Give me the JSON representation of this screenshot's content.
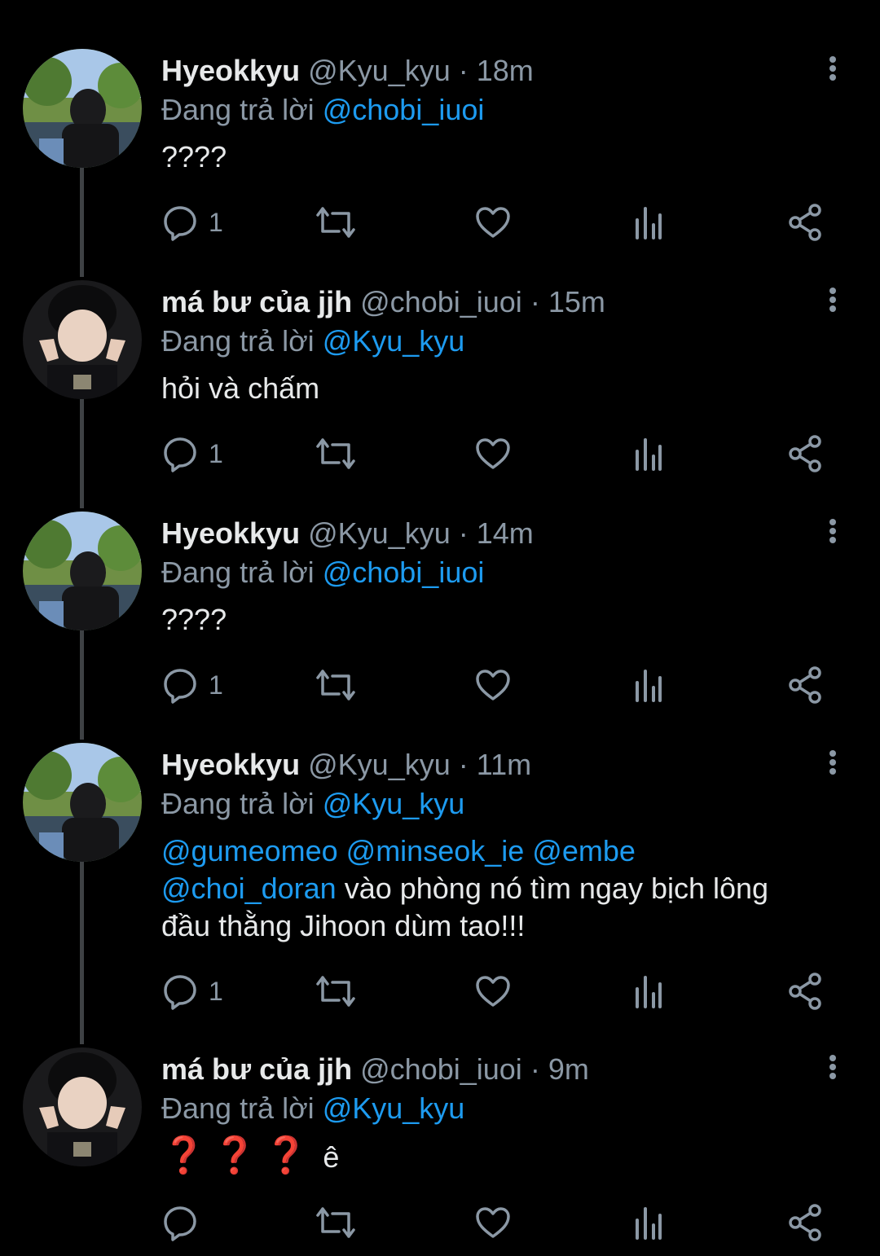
{
  "tweets": [
    {
      "name": "Hyeokkyu",
      "handle": "@Kyu_kyu",
      "dot": "·",
      "time": "18m",
      "reply_prefix": "Đang trả lời",
      "reply_to": "@chobi_iuoi",
      "text": "????",
      "reply_count": "1",
      "avatar": "hyeokkyu"
    },
    {
      "name": "má bư của jjh",
      "handle": "@chobi_iuoi",
      "dot": "·",
      "time": "15m",
      "reply_prefix": "Đang trả lời",
      "reply_to": "@Kyu_kyu",
      "text": "hỏi và chấm",
      "reply_count": "1",
      "avatar": "chobi"
    },
    {
      "name": "Hyeokkyu",
      "handle": "@Kyu_kyu",
      "dot": "·",
      "time": "14m",
      "reply_prefix": "Đang trả lời",
      "reply_to": "@chobi_iuoi",
      "text": "????",
      "reply_count": "1",
      "avatar": "hyeokkyu"
    },
    {
      "name": "Hyeokkyu",
      "handle": "@Kyu_kyu",
      "dot": "·",
      "time": "11m",
      "reply_prefix": "Đang trả lời",
      "reply_to": "@Kyu_kyu",
      "text_mentions_line1": "@gumeomeo @minseok_ie @embe",
      "text_mention_line2": "@choi_doran",
      "text_line2_rest": " vào phòng nó tìm ngay bịch lông",
      "text_line3": "đầu thằng Jihoon dùm tao!!!",
      "reply_count": "1",
      "avatar": "hyeokkyu"
    },
    {
      "name": "má bư của jjh",
      "handle": "@chobi_iuoi",
      "dot": "·",
      "time": "9m",
      "reply_prefix": "Đang trả lời",
      "reply_to": "@Kyu_kyu",
      "emoji_q": "❓",
      "text_tail": "ê",
      "reply_count": "",
      "avatar": "chobi"
    }
  ],
  "icons": [
    "reply-icon",
    "retweet-icon",
    "like-icon",
    "analytics-icon",
    "share-icon",
    "more-options-icon"
  ],
  "colors": {
    "background": "#000000",
    "text": "#e7e9ea",
    "muted": "#8b98a5",
    "mention": "#1d9bf0",
    "thread_line": "#3e4144",
    "emoji_red": "#e0201d"
  }
}
